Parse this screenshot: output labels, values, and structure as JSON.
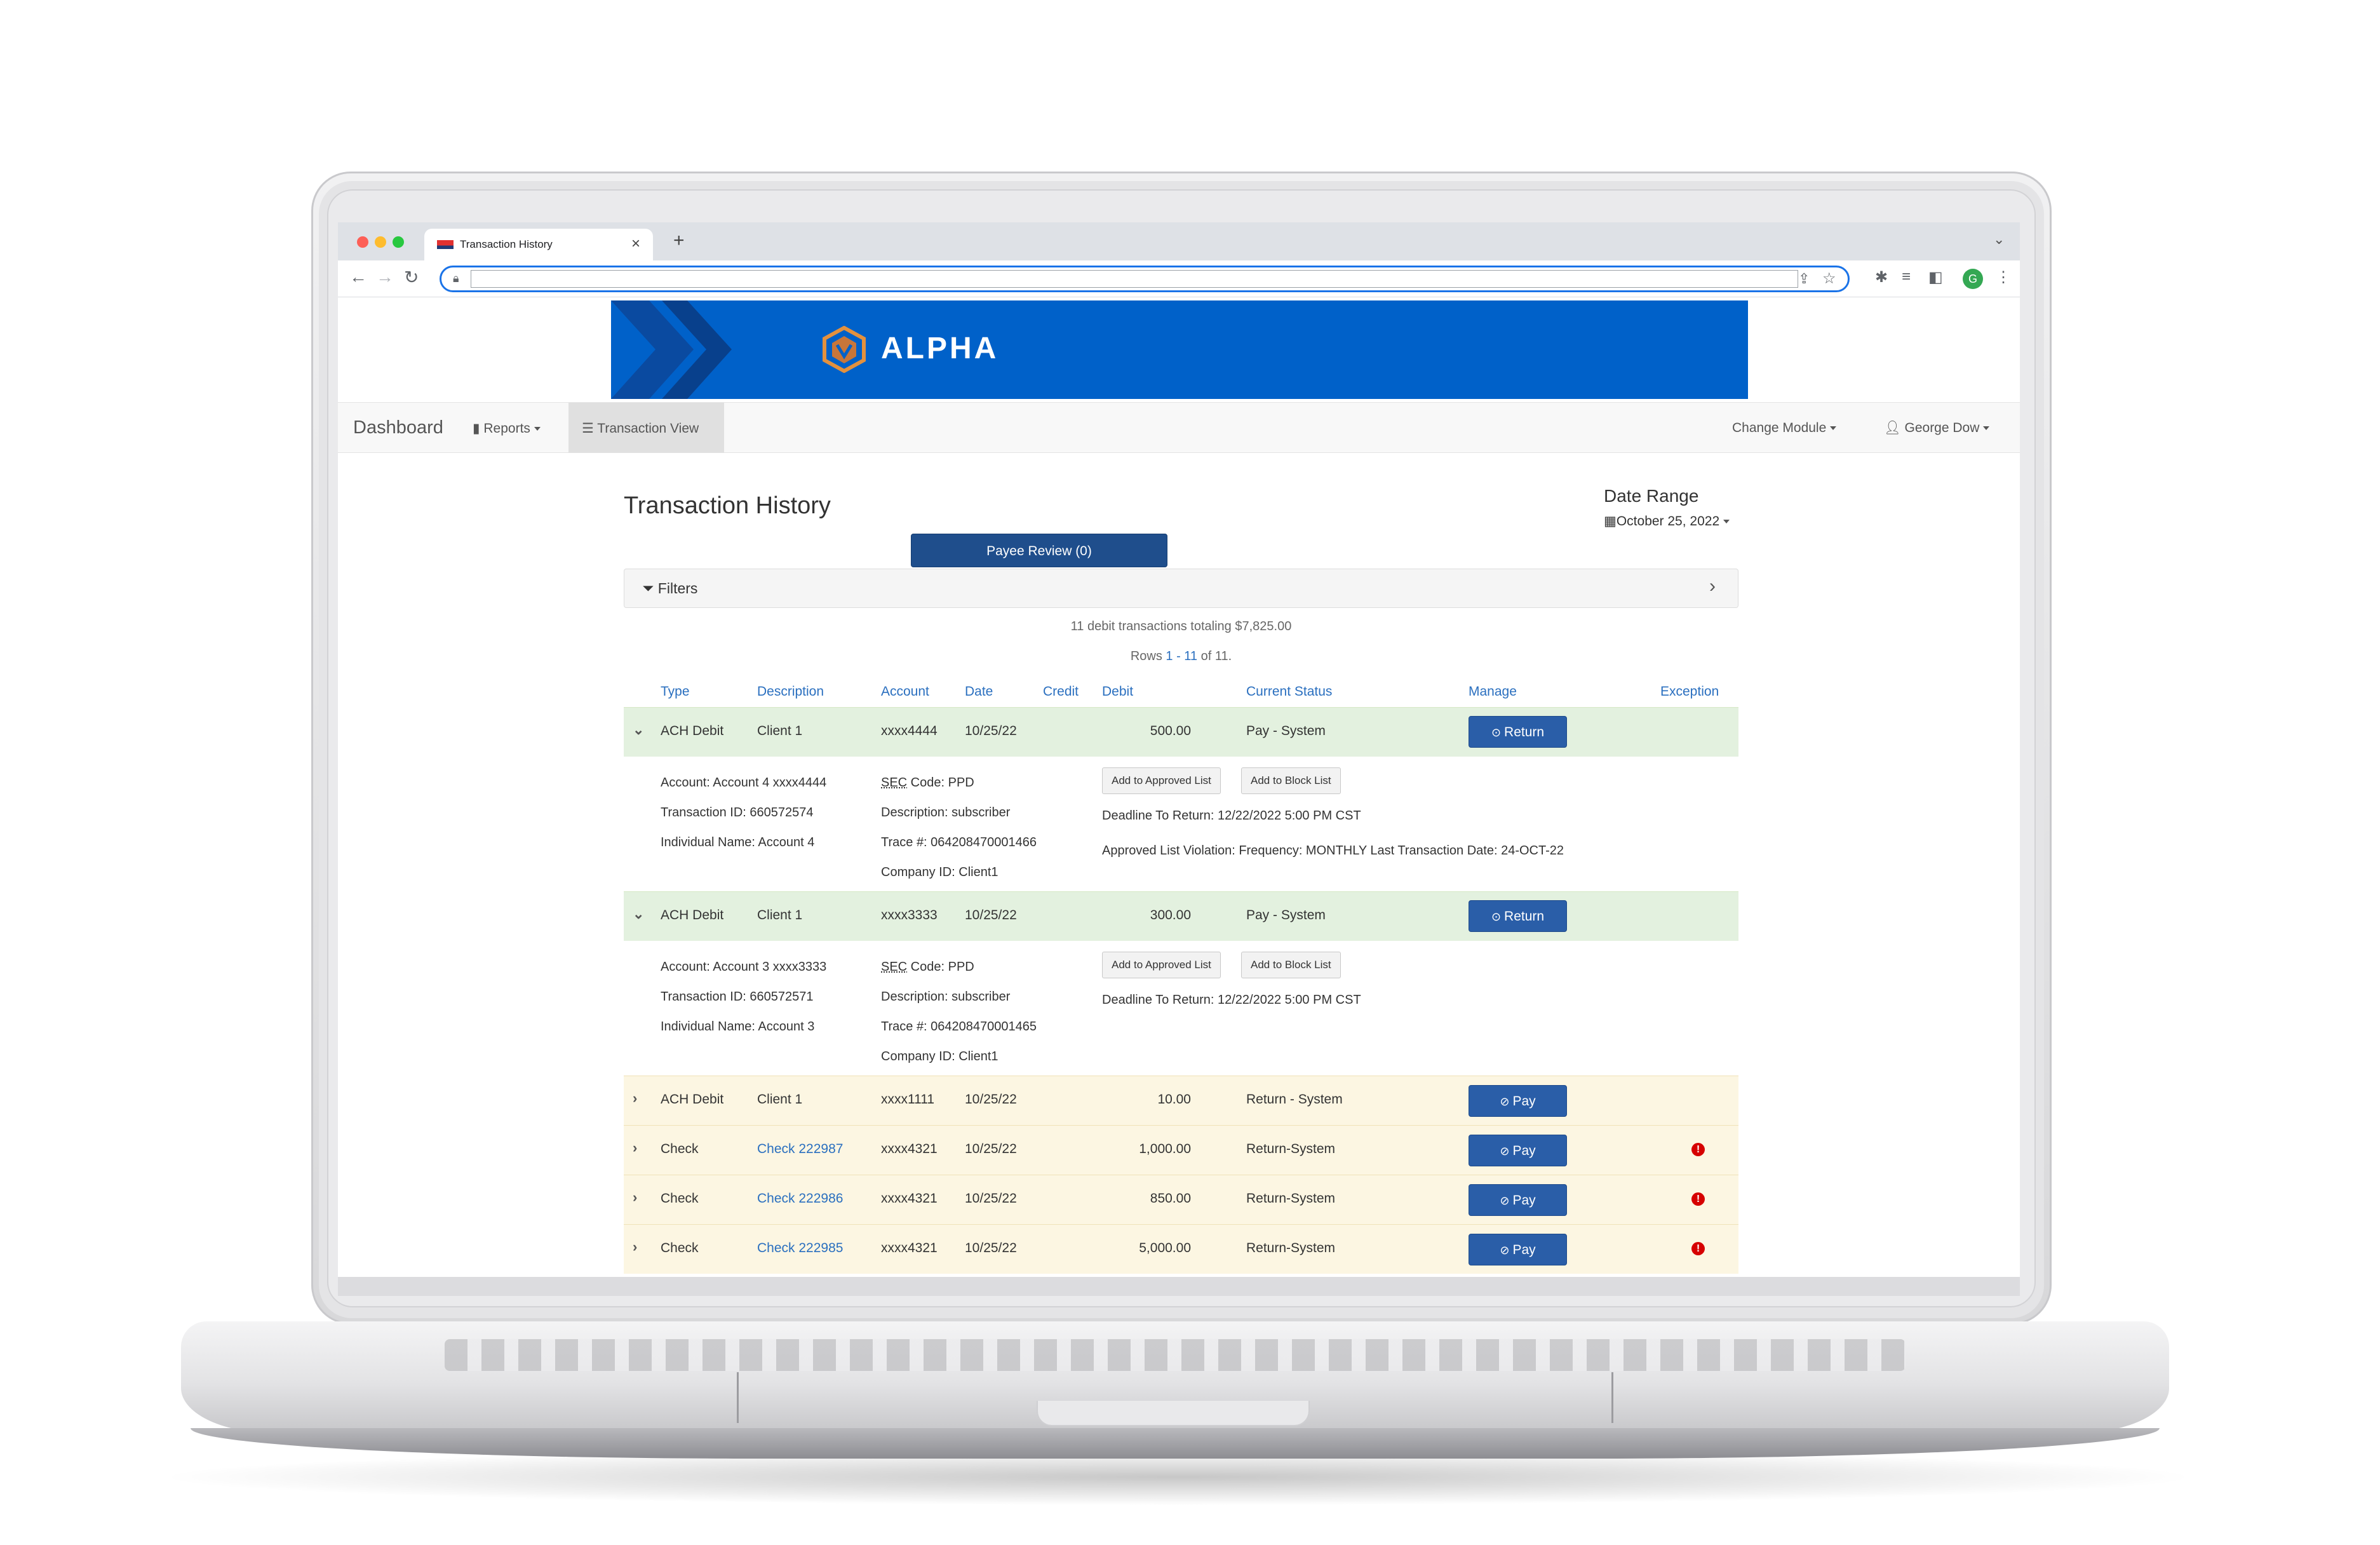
{
  "browser": {
    "tab_title": "Transaction History",
    "tab_close": "×",
    "new_tab": "+",
    "url": ""
  },
  "banner": {
    "brand": "ALPHA",
    "color": "#0061c9"
  },
  "nav": {
    "dashboard": "Dashboard",
    "reports": "Reports",
    "transaction_view": "Transaction View",
    "change_module": "Change Module",
    "user": "George Dow"
  },
  "page": {
    "title": "Transaction History",
    "date_range_label": "Date Range",
    "date_range_value": "October 25, 2022",
    "payee_review": "Payee Review (0)",
    "filters": "Filters",
    "summary": "11 debit transactions totaling $7,825.00",
    "rows_prefix": "Rows ",
    "rows_start": "1",
    "rows_dash": " - ",
    "rows_end": "11",
    "rows_suffix": " of 11."
  },
  "columns": [
    "Type",
    "Description",
    "Account",
    "Date",
    "Credit",
    "Debit",
    "Current Status",
    "Manage",
    "Exception"
  ],
  "rows": [
    {
      "type": "ACH Debit",
      "description": "Client 1",
      "account": "xxxx4444",
      "date": "10/25/22",
      "credit": "",
      "debit": "500.00",
      "status": "Pay - System",
      "manage": "Return",
      "exception": false,
      "detail": {
        "col1": [
          "Account: Account 4 xxxx4444",
          "Transaction ID: 660572574",
          "Individual Name: Account 4"
        ],
        "sec_abbr": "SEC",
        "sec_rest": " Code: PPD",
        "col2": [
          "Description: subscriber",
          "Trace #: 064208470001466",
          "Company ID: Client1"
        ],
        "btn_approved": "Add to Approved List",
        "btn_block": "Add to Block List",
        "deadline": "Deadline To Return: 12/22/2022 5:00 PM CST",
        "violation": "Approved List Violation: Frequency: MONTHLY Last Transaction Date: 24-OCT-22"
      }
    },
    {
      "type": "ACH Debit",
      "description": "Client 1",
      "account": "xxxx3333",
      "date": "10/25/22",
      "credit": "",
      "debit": "300.00",
      "status": "Pay - System",
      "manage": "Return",
      "exception": false,
      "detail": {
        "col1": [
          "Account: Account 3 xxxx3333",
          "Transaction ID: 660572571",
          "Individual Name: Account 3"
        ],
        "sec_abbr": "SEC",
        "sec_rest": " Code: PPD",
        "col2": [
          "Description: subscriber",
          "Trace #: 064208470001465",
          "Company ID: Client1"
        ],
        "btn_approved": "Add to Approved List",
        "btn_block": "Add to Block List",
        "deadline": "Deadline To Return: 12/22/2022 5:00 PM CST"
      }
    },
    {
      "type": "ACH Debit",
      "description": "Client 1",
      "account": "xxxx1111",
      "date": "10/25/22",
      "credit": "",
      "debit": "10.00",
      "status": "Return - System",
      "manage": "Pay",
      "exception": false
    },
    {
      "type": "Check",
      "description": "Check 222987",
      "account": "xxxx4321",
      "date": "10/25/22",
      "credit": "",
      "debit": "1,000.00",
      "status": "Return-System",
      "manage": "Pay",
      "exception": true
    },
    {
      "type": "Check",
      "description": "Check 222986",
      "account": "xxxx4321",
      "date": "10/25/22",
      "credit": "",
      "debit": "850.00",
      "status": "Return-System",
      "manage": "Pay",
      "exception": true
    },
    {
      "type": "Check",
      "description": "Check 222985",
      "account": "xxxx4321",
      "date": "10/25/22",
      "credit": "",
      "debit": "5,000.00",
      "status": "Return-System",
      "manage": "Pay",
      "exception": true
    }
  ],
  "icons": {
    "expanded": "chevron-down-icon",
    "collapsed": "chevron-right-icon",
    "return": "circle-arrow-icon",
    "pay": "circle-check-icon",
    "exception": "exclamation-circle-icon"
  }
}
